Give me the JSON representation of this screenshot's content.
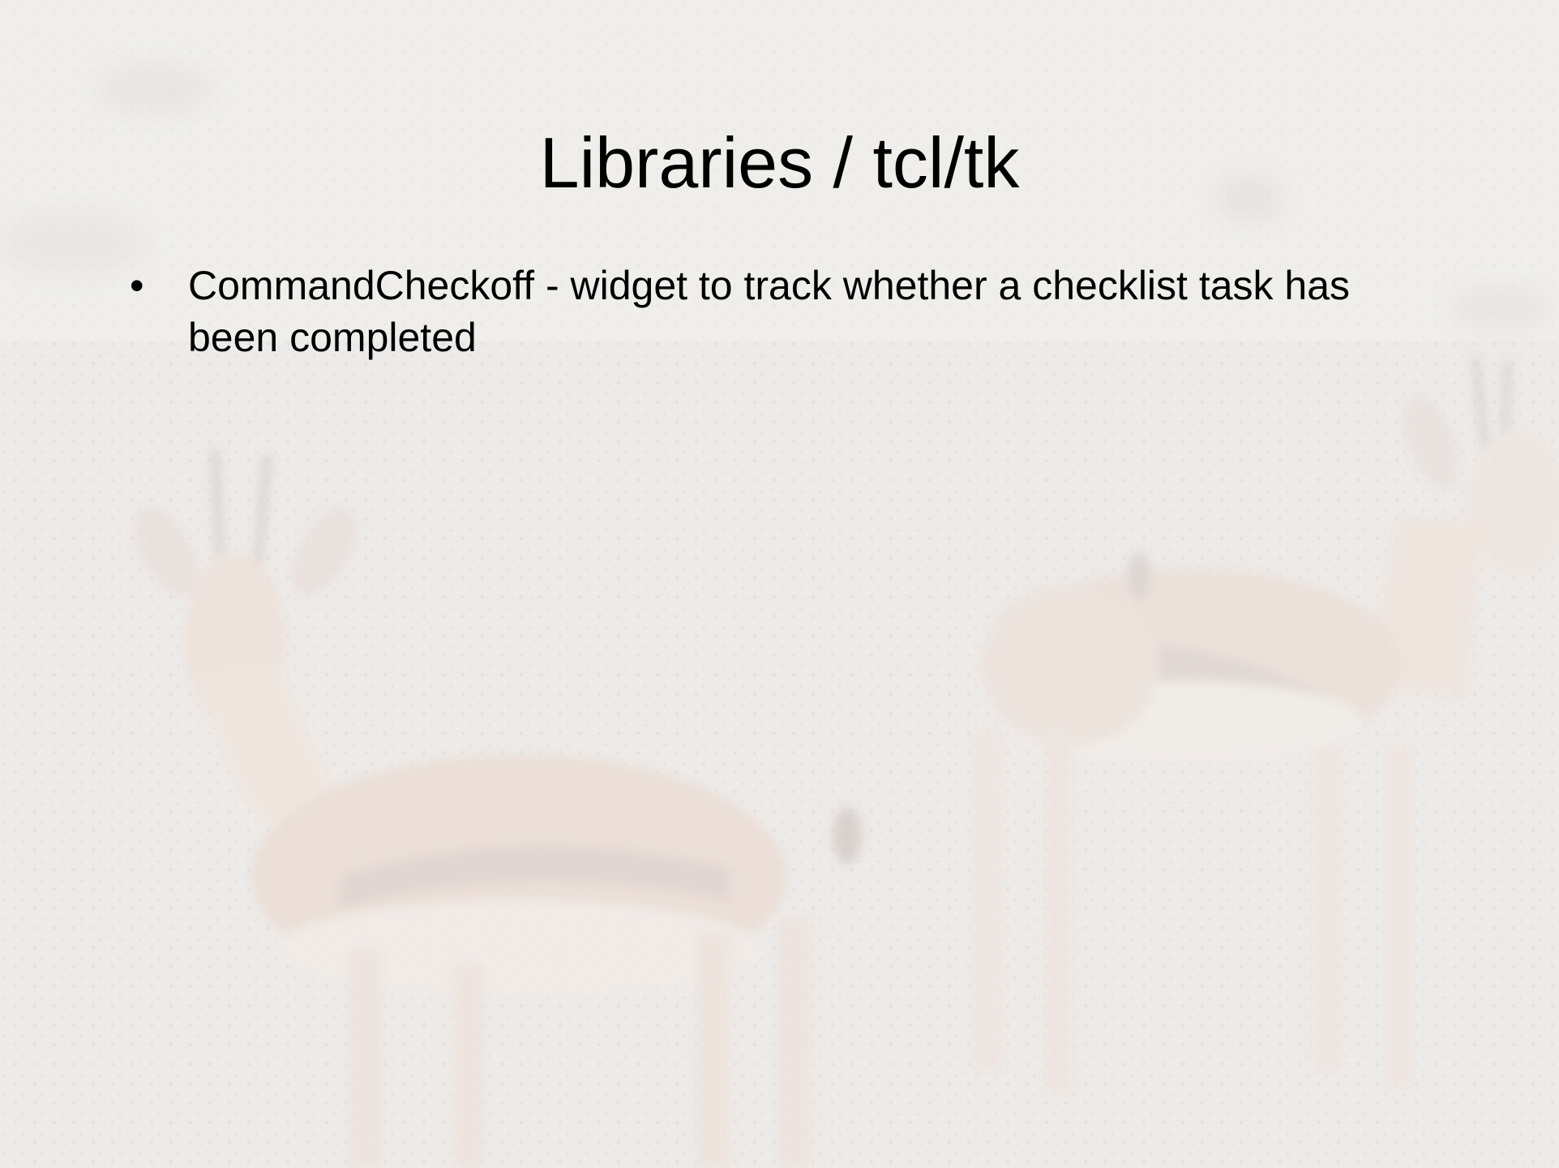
{
  "slide": {
    "title": "Libraries / tcl/tk",
    "bullets": [
      {
        "marker": "•",
        "text": "CommandCheckoff - widget to track whether a checklist task has been completed"
      }
    ]
  },
  "colors": {
    "background": "#efeceb",
    "text": "#000000",
    "gazelle_body": "#e8d6cb",
    "gazelle_stripe": "#d9c8c3"
  },
  "background_image": {
    "subject": "faded photo of gazelles on savanna"
  }
}
